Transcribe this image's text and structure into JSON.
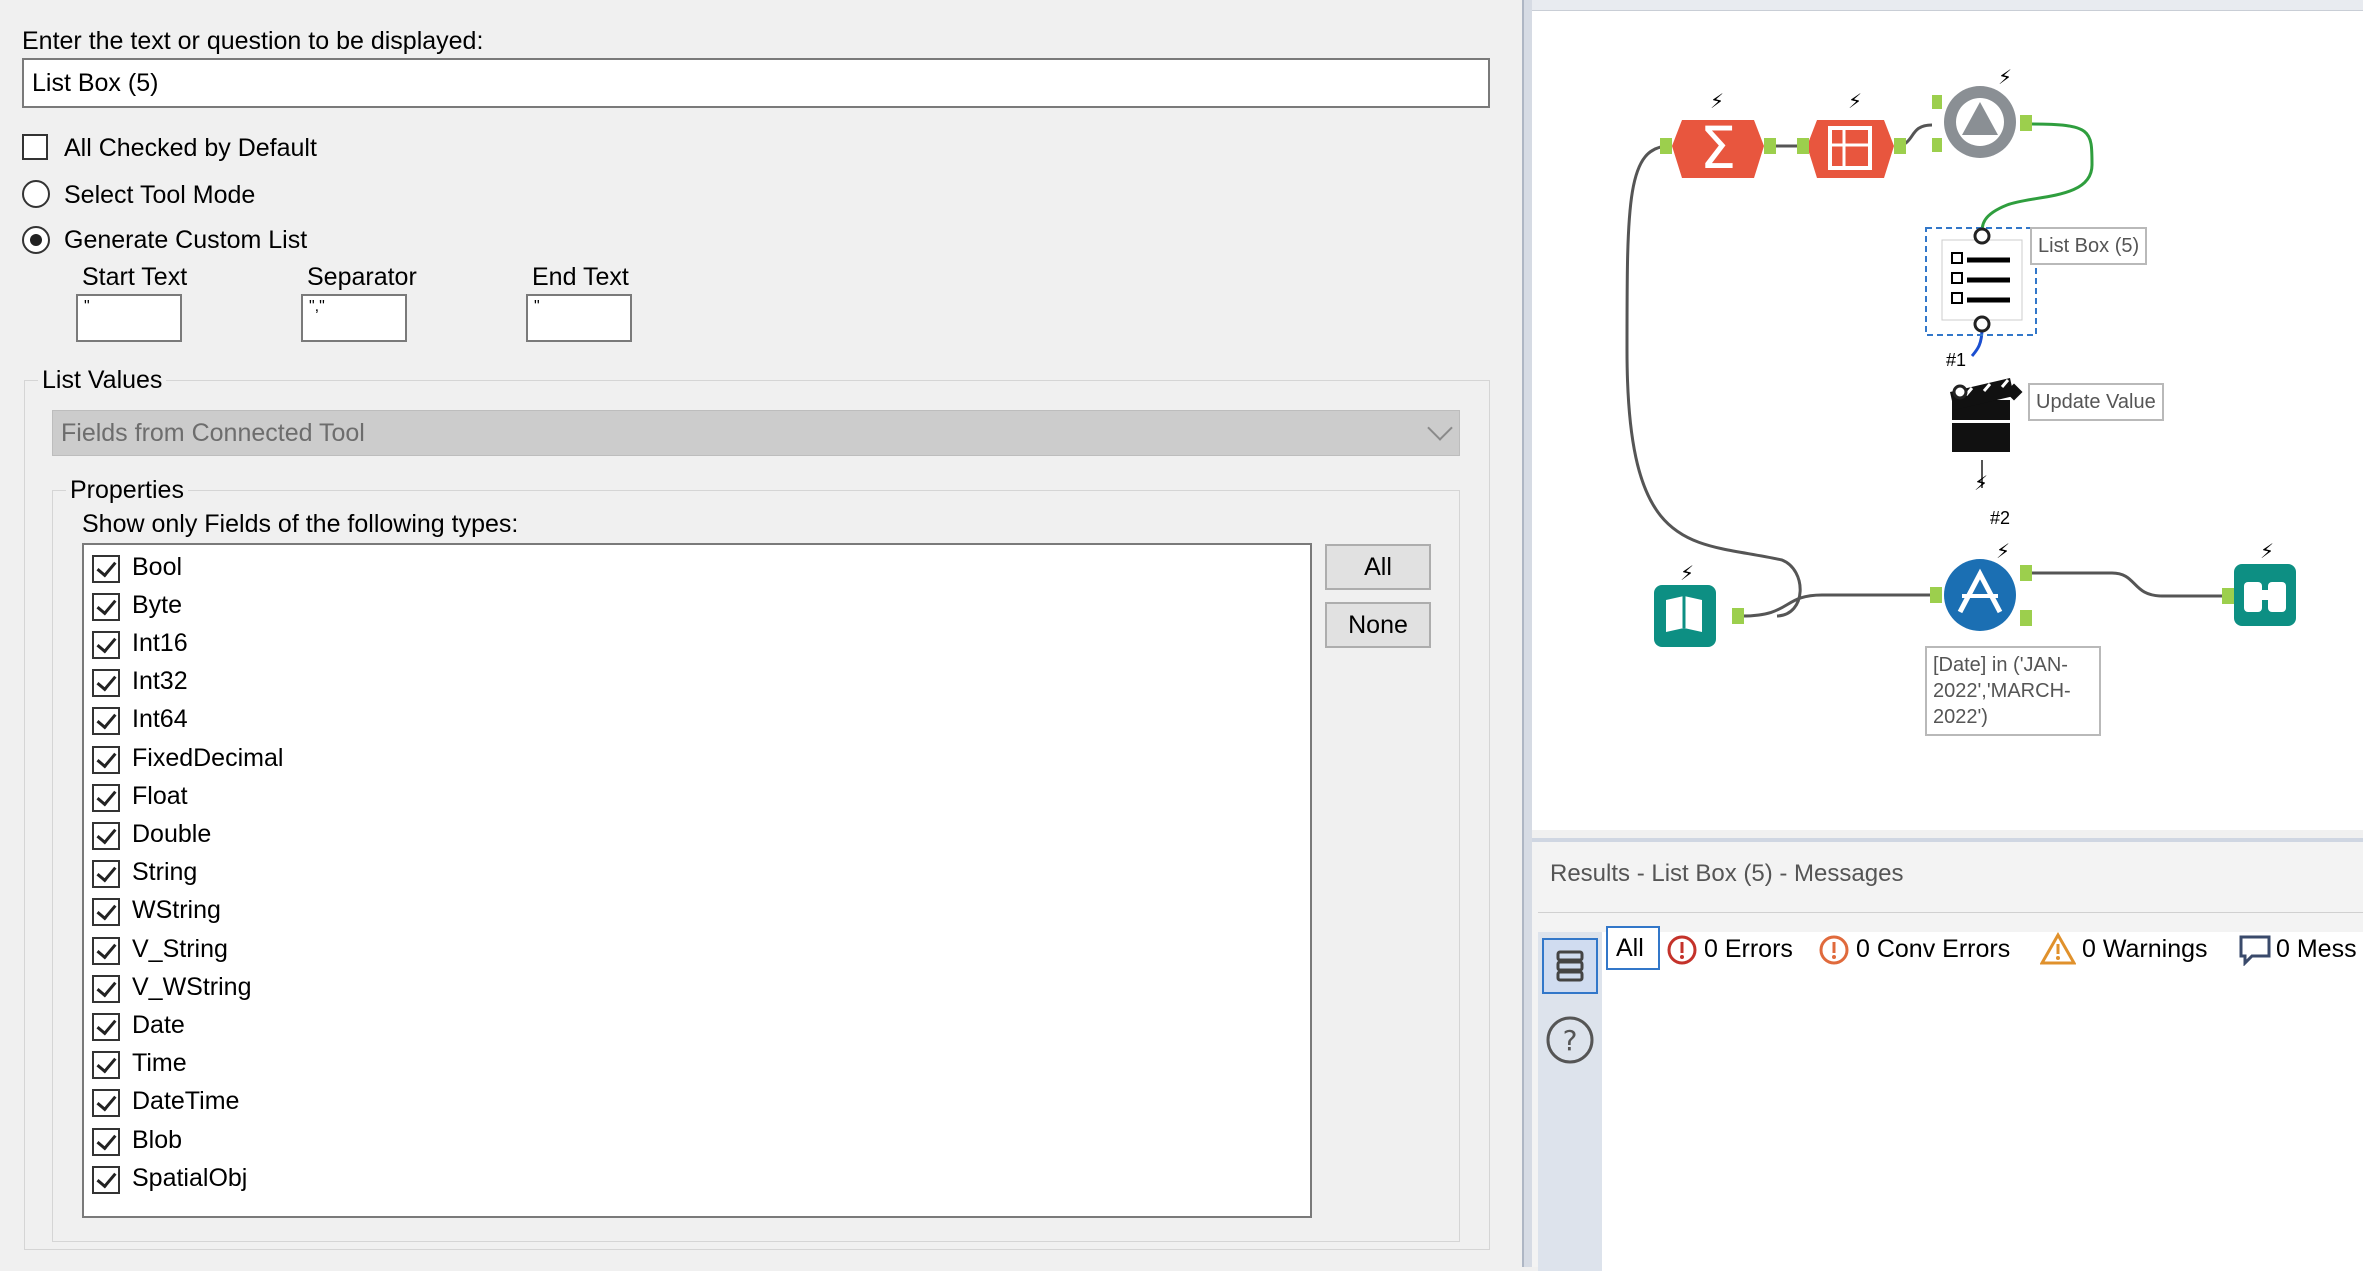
{
  "config": {
    "question_label": "Enter the text or question to be displayed:",
    "question_value": "List Box (5)",
    "all_checked_label": "All Checked by Default",
    "select_tool_mode_label": "Select Tool Mode",
    "generate_custom_list_label": "Generate Custom List",
    "start_text_label": "Start Text",
    "start_text_value": "\"",
    "separator_label": "Separator",
    "separator_value": "\",\"",
    "end_text_label": "End Text",
    "end_text_value": "\"",
    "list_values_label": "List Values",
    "list_values_selected": "Fields from Connected Tool",
    "properties_label": "Properties",
    "types_label": "Show only Fields of the following types:",
    "types": [
      "Bool",
      "Byte",
      "Int16",
      "Int32",
      "Int64",
      "FixedDecimal",
      "Float",
      "Double",
      "String",
      "WString",
      "V_String",
      "V_WString",
      "Date",
      "Time",
      "DateTime",
      "Blob",
      "SpatialObj"
    ],
    "all_button": "All",
    "none_button": "None"
  },
  "canvas": {
    "listbox_label": "List Box (5)",
    "update_value_label": "Update Value",
    "filter_label": "[Date] in ('JAN-2022','MARCH-2022')",
    "anchor_1": "#1",
    "anchor_2": "#2",
    "colors": {
      "accent_orange": "#e8563e",
      "teal": "#0d8f83",
      "blue": "#1b6fb3",
      "wire_green": "#2f9e3e"
    }
  },
  "results": {
    "title": "Results - List Box (5) - Messages",
    "tab_all": "All",
    "tab_errors": "0 Errors",
    "tab_conv_errors": "0 Conv Errors",
    "tab_warnings": "0 Warnings",
    "tab_messages": "0 Mess"
  }
}
